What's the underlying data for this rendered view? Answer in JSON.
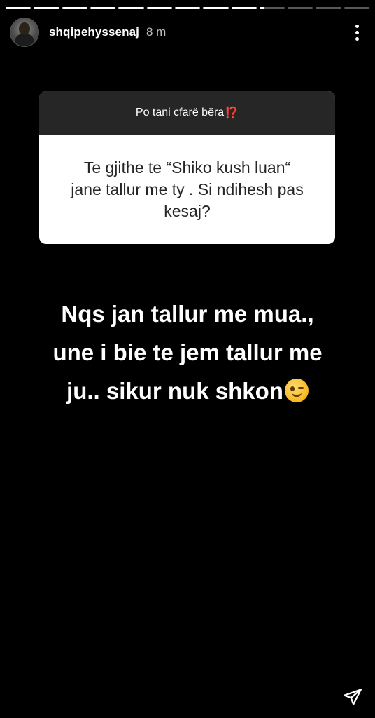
{
  "story": {
    "segments_total": 13,
    "segments_complete": 9,
    "current_segment_progress": 0.2
  },
  "header": {
    "username": "shqipehyssenaj",
    "timestamp": "8 m"
  },
  "question_card": {
    "prompt": "Po tani cfarë bëra",
    "prompt_emoji": "⁉️",
    "question": "Te gjithe te “Shiko kush luan“ jane tallur me ty . Si ndihesh pas kesaj?"
  },
  "reply": {
    "line1": "Nqs jan tallur me mua.,",
    "line2": "une i bie te jem tallur me",
    "line3": "ju.. sikur nuk shkon"
  },
  "icons": {
    "more": "more-vertical-icon",
    "share": "send-icon",
    "emoji": "winking-face-icon"
  },
  "colors": {
    "background": "#000000",
    "card_header": "#262626",
    "card_body": "#ffffff",
    "accent": "#e0245e"
  }
}
